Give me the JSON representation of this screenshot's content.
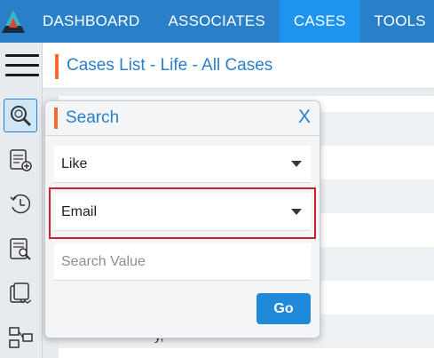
{
  "nav": {
    "items": [
      {
        "label": "DASHBOARD",
        "active": false
      },
      {
        "label": "ASSOCIATES",
        "active": false
      },
      {
        "label": "CASES",
        "active": true
      },
      {
        "label": "TOOLS",
        "active": false
      }
    ]
  },
  "header": {
    "title": "Cases List - Life - All Cases"
  },
  "sidebar": {
    "tools": [
      {
        "icon": "search-icon",
        "active": true
      },
      {
        "icon": "add-document-icon",
        "active": false
      },
      {
        "icon": "history-icon",
        "active": false
      },
      {
        "icon": "document-search-icon",
        "active": false
      },
      {
        "icon": "forward-documents-icon",
        "active": false
      },
      {
        "icon": "workflow-icon",
        "active": false
      }
    ]
  },
  "background": {
    "partial_row_text": "y,"
  },
  "search": {
    "title": "Search",
    "close_label": "X",
    "operator_value": "Like",
    "field_value": "Email",
    "value_placeholder": "Search Value",
    "go_label": "Go"
  },
  "colors": {
    "nav_bg": "#2a7fc9",
    "nav_active": "#1d94f0",
    "accent_orange": "#f26a2e",
    "highlight_red": "#d0202a",
    "button_blue": "#1f8ad9"
  }
}
